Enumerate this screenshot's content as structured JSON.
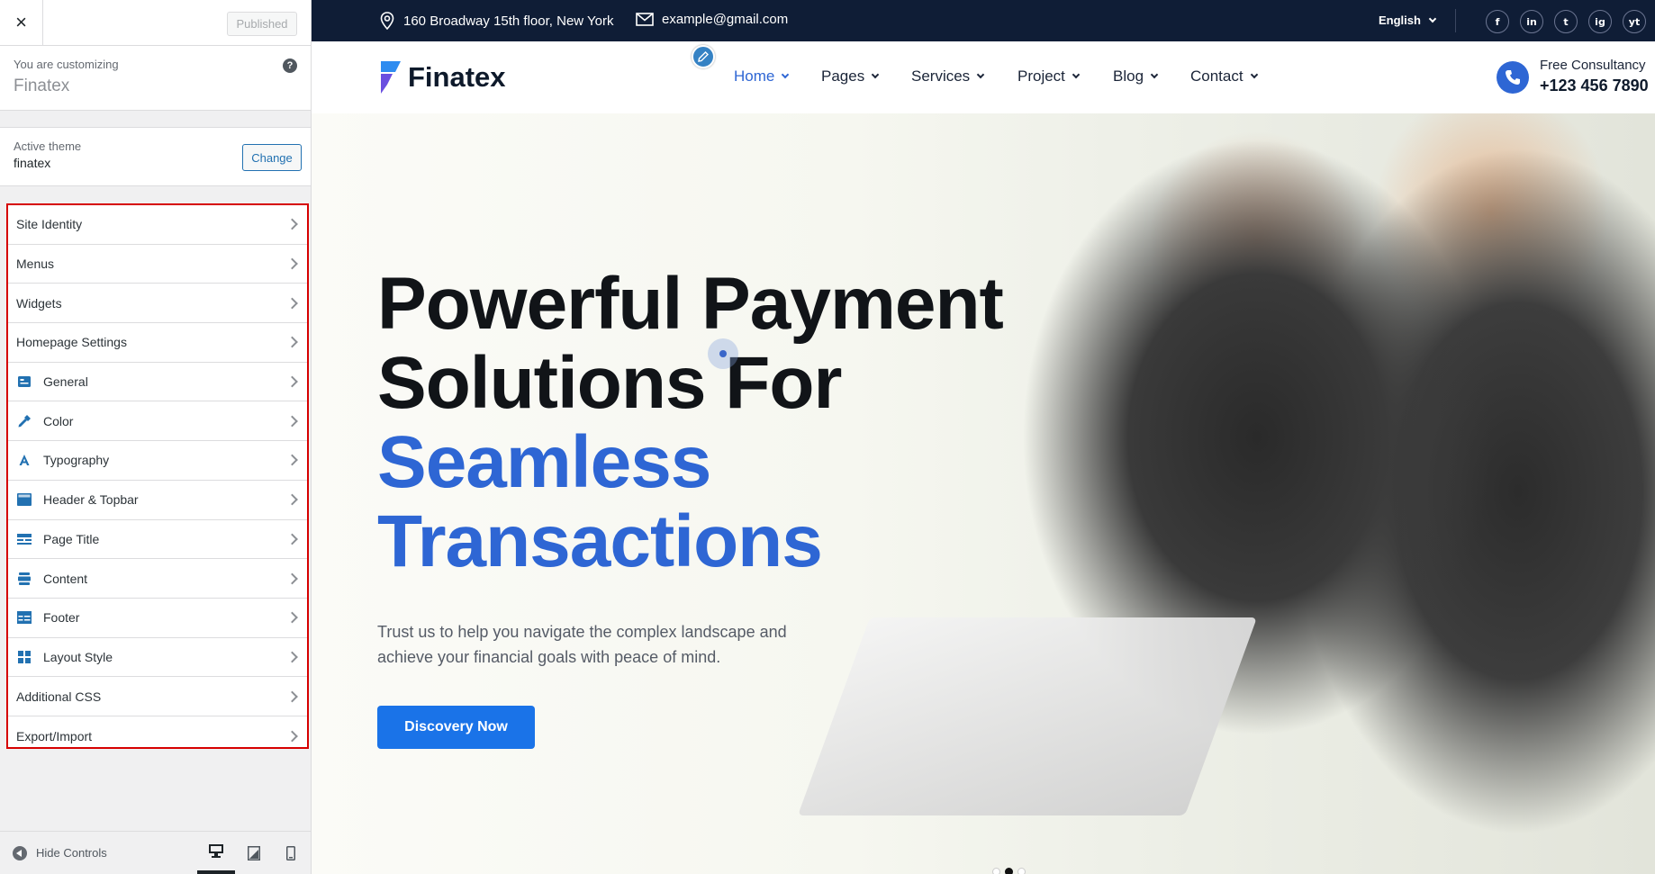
{
  "customizer": {
    "close_label": "×",
    "status_button": "Published",
    "customizing_label": "You are customizing",
    "site_name": "Finatex",
    "help_label": "?",
    "active_theme_label": "Active theme",
    "active_theme_name": "finatex",
    "change_button": "Change",
    "panels": [
      {
        "label": "Site Identity",
        "icon": "none"
      },
      {
        "label": "Menus",
        "icon": "none"
      },
      {
        "label": "Widgets",
        "icon": "none"
      },
      {
        "label": "Homepage Settings",
        "icon": "none"
      },
      {
        "label": "General",
        "icon": "general-icon"
      },
      {
        "label": "Color",
        "icon": "color-picker-icon"
      },
      {
        "label": "Typography",
        "icon": "typography-icon"
      },
      {
        "label": "Header & Topbar",
        "icon": "header-icon"
      },
      {
        "label": "Page Title",
        "icon": "page-title-icon"
      },
      {
        "label": "Content",
        "icon": "content-icon"
      },
      {
        "label": "Footer",
        "icon": "footer-icon"
      },
      {
        "label": "Layout Style",
        "icon": "layout-icon"
      },
      {
        "label": "Additional CSS",
        "icon": "none"
      },
      {
        "label": "Export/Import",
        "icon": "none"
      }
    ],
    "hide_controls_label": "Hide Controls",
    "devices": [
      "desktop",
      "tablet",
      "mobile"
    ],
    "accent_color": "#2271b1",
    "highlight_border_color": "#d60000"
  },
  "site": {
    "topbar": {
      "address": "160 Broadway 15th floor, New York",
      "email": "example@gmail.com",
      "language": "English",
      "social": [
        "f",
        "in",
        "t",
        "ig",
        "yt"
      ]
    },
    "logo_text": "Finatex",
    "nav": [
      {
        "label": "Home",
        "active": true
      },
      {
        "label": "Pages",
        "active": false
      },
      {
        "label": "Services",
        "active": false
      },
      {
        "label": "Project",
        "active": false
      },
      {
        "label": "Blog",
        "active": false
      },
      {
        "label": "Contact",
        "active": false
      }
    ],
    "consultancy_label": "Free Consultancy",
    "phone": "+123 456 7890",
    "hero": {
      "line1": "Powerful Payment",
      "line2": "Solutions For",
      "line3": "Seamless",
      "line4": "Transactions",
      "description": "Trust us to help you navigate the complex landscape and achieve your financial goals with peace of mind.",
      "cta": "Discovery Now"
    },
    "brand_color": "#2e66d4",
    "topbar_color": "#0f1d36",
    "slides": 3,
    "active_slide": 2
  }
}
